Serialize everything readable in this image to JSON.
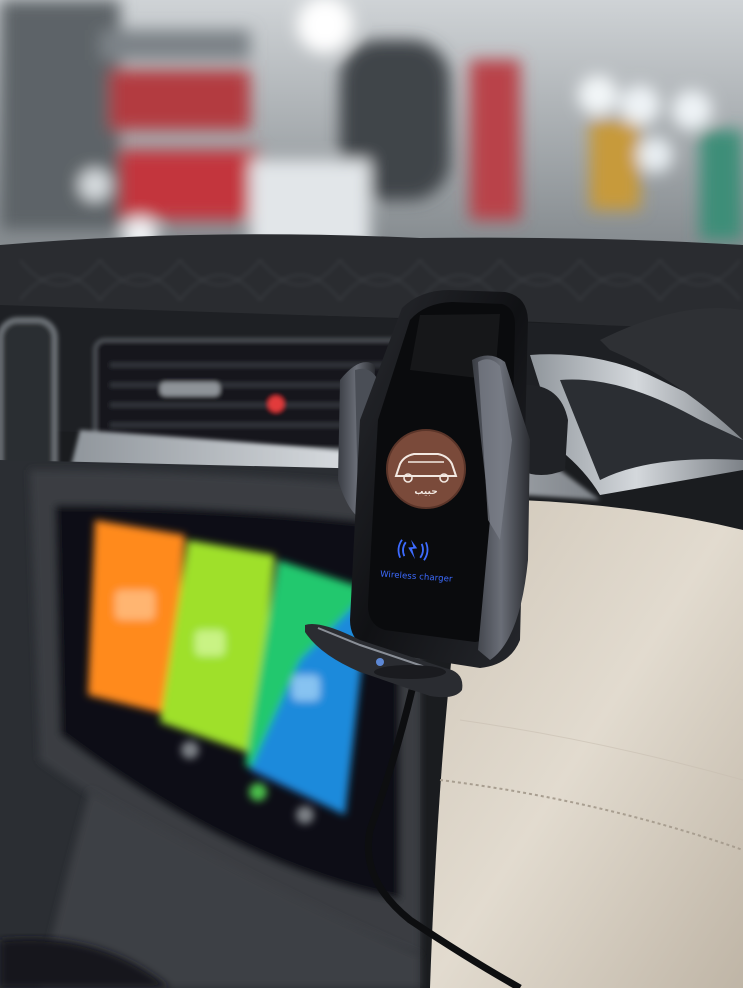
{
  "scene": {
    "kind": "product photo",
    "subject": "wireless charger phone holder mounted on car dashboard air vent",
    "brand_logo_icon": "car-outline-logo",
    "charging_icon": "wireless-charging-icon",
    "charger_text": "Wireless charger",
    "logo_text": "ﺣﺒﻴﺐ",
    "colors": {
      "logo_badge": "#7a4a3a",
      "charger_text": "#3d6bff",
      "screen_orange": "#ff8a1e",
      "screen_yellowgreen": "#a6e22a",
      "screen_green_blue": "#2cc86a",
      "holder_body": "#1b1d22",
      "dashboard_leather": "#d8d0c4"
    }
  }
}
